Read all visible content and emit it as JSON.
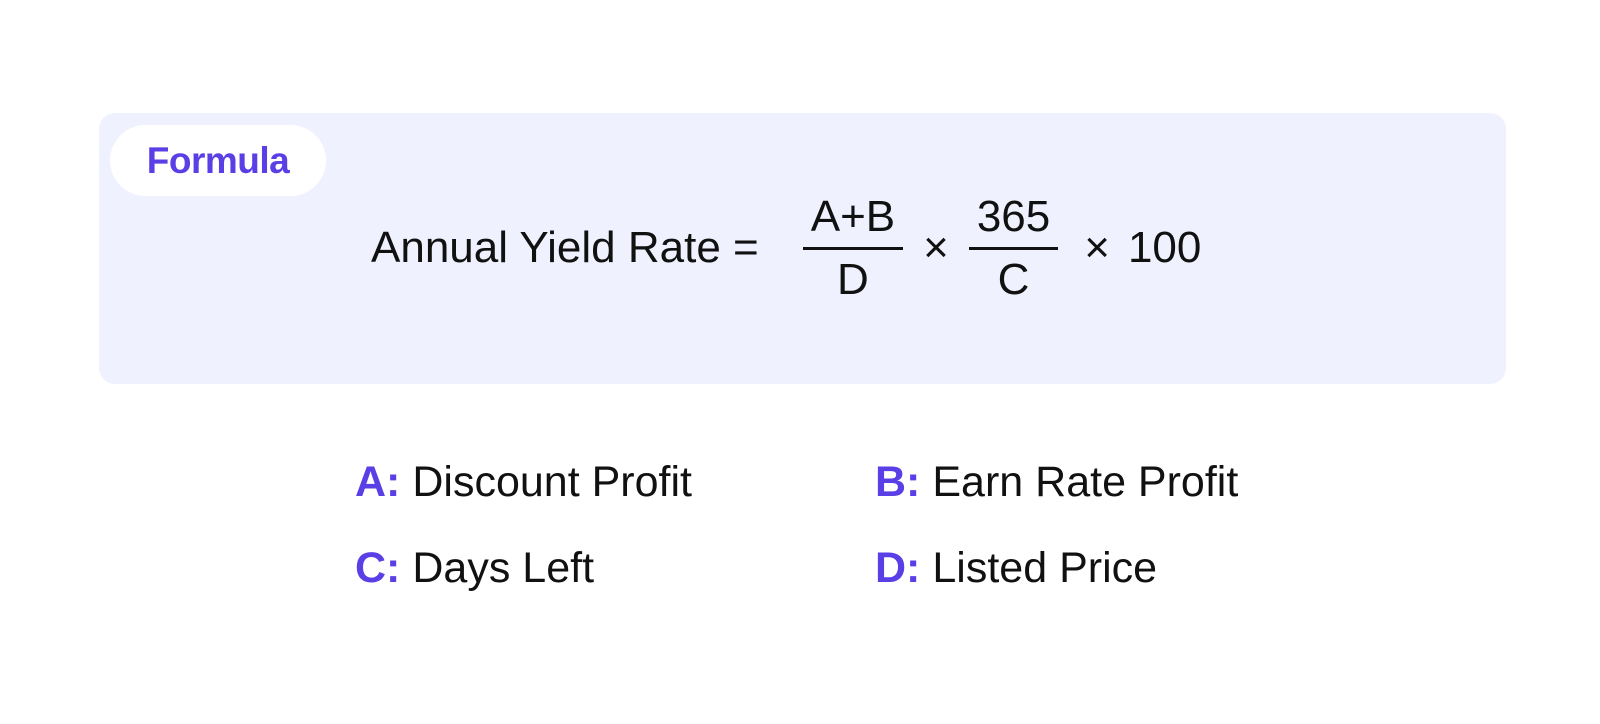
{
  "tag": {
    "label": "Formula"
  },
  "equation": {
    "lhs": "Annual Yield Rate =",
    "fraction1": {
      "numerator": "A+B",
      "denominator": "D"
    },
    "times1": "×",
    "fraction2": {
      "numerator": "365",
      "denominator": "C"
    },
    "times2": "×",
    "multiplier": "100"
  },
  "legend": [
    {
      "key": "A:",
      "text": "Discount Profit"
    },
    {
      "key": "B:",
      "text": "Earn Rate Profit"
    },
    {
      "key": "C:",
      "text": "Days Left"
    },
    {
      "key": "D:",
      "text": "Listed Price"
    }
  ],
  "colors": {
    "accent": "#5a3fe6",
    "card_background": "#eff2fe",
    "text": "#111111"
  }
}
